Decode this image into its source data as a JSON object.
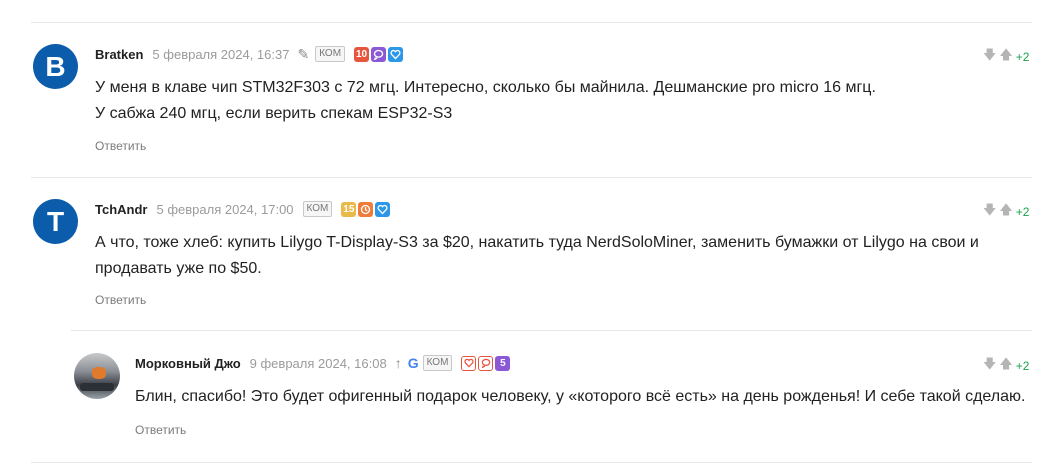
{
  "comments": [
    {
      "avatar_letter": "B",
      "author": "Bratken",
      "date": "5 февраля 2024, 16:37",
      "kom": "КОМ",
      "badge_number": "10",
      "lines": [
        "У меня в клаве чип STM32F303 с 72 мгц. Интересно, сколько бы майнила. Дешманские pro micro 16 мгц.",
        "У сабжа 240 мгц, если верить спекам ESP32-S3"
      ],
      "reply": "Ответить",
      "score": "+2"
    },
    {
      "avatar_letter": "T",
      "author": "TchAndr",
      "date": "5 февраля 2024, 17:00",
      "kom": "КОМ",
      "badge_number": "15",
      "lines": [
        "А что, тоже хлеб: купить Lilygo T-Display-S3 за $20, накатить туда NerdSoloMiner, заменить бумажки от Lilygo на свои и",
        "продавать уже по $50."
      ],
      "reply": "Ответить",
      "score": "+2"
    },
    {
      "author": "Морковный Джо",
      "date": "9 февраля 2024, 16:08",
      "kom": "КОМ",
      "badge_number": "5",
      "lines": [
        "Блин, спасибо! Это будет офигенный подарок человеку, у «которого всё есть» на день рожденья! И себе такой сделаю."
      ],
      "reply": "Ответить",
      "score": "+2"
    }
  ],
  "icons": {
    "edit": "pencil-icon",
    "pinned": "arrow-up-icon",
    "google": "google-icon",
    "vote_down": "arrow-down-icon",
    "vote_up": "arrow-up-icon"
  },
  "colors": {
    "avatar": "#0b5cab",
    "score": "#1aa34a",
    "date": "#9b9b9b",
    "reply": "#7a7a7a"
  }
}
